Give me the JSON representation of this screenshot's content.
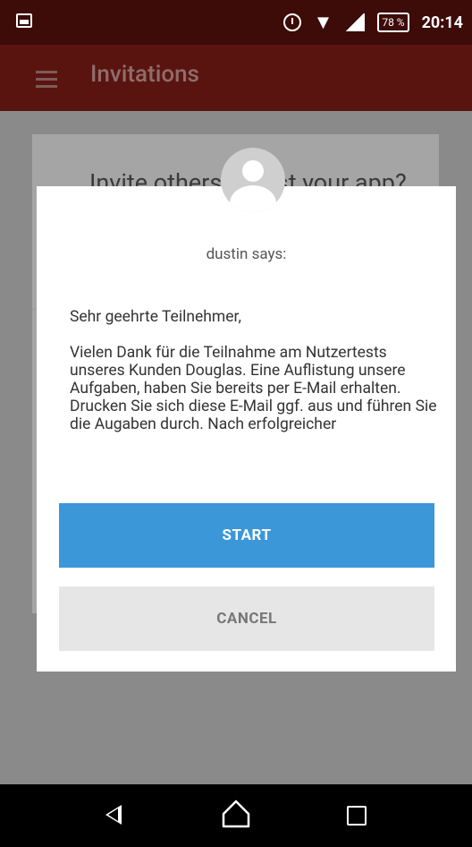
{
  "status_bar": {
    "battery": "78 %",
    "time": "20:14"
  },
  "app_bar": {
    "title": "Invitations"
  },
  "background_card": {
    "text": "Invite others to test your app?"
  },
  "dialog": {
    "sender": "dustin says:",
    "greeting": "Sehr geehrte Teilnehmer,",
    "body": "Vielen Dank für die Teilnahme am Nutzertests unseres Kunden Douglas. Eine Auflistung unsere Aufgaben, haben Sie bereits per E-Mail erhalten. Drucken Sie sich diese E-Mail ggf. aus und führen Sie die Augaben durch. Nach erfolgreicher",
    "start_label": "START",
    "cancel_label": "CANCEL"
  },
  "colors": {
    "status_bar": "#3d0b08",
    "app_bar": "#5a1410",
    "start_button": "#3b97d8",
    "cancel_button": "#e6e6e6"
  },
  "icons": [
    "gallery-icon",
    "alarm-icon",
    "wifi-icon",
    "signal-icon",
    "battery-icon",
    "menu-icon",
    "avatar-icon",
    "back-icon",
    "home-icon",
    "recents-icon"
  ]
}
